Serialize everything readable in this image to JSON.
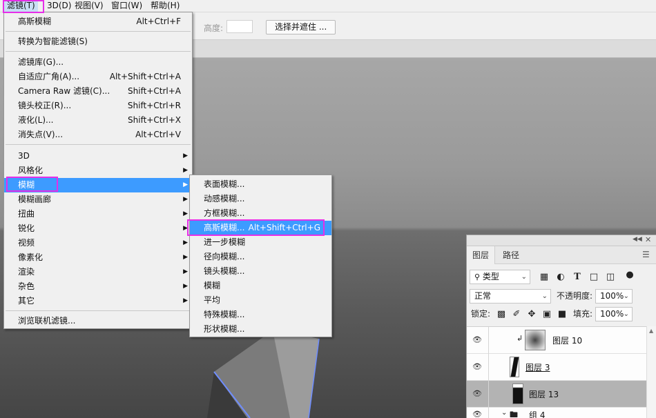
{
  "menubar": {
    "filter": "滤镜(T)",
    "3d": "3D(D)",
    "view": "视图(V)",
    "window": "窗口(W)",
    "help": "帮助(H)"
  },
  "options": {
    "height_label": "高度:",
    "height_value": "",
    "select_mask_button": "选择并遮住 ..."
  },
  "filter_menu": {
    "items": [
      {
        "label": "高斯模糊",
        "shortcut": "Alt+Ctrl+F"
      },
      {
        "label": "转换为智能滤镜(S)",
        "shortcut": ""
      },
      {
        "label": "滤镜库(G)...",
        "shortcut": ""
      },
      {
        "label": "自适应广角(A)...",
        "shortcut": "Alt+Shift+Ctrl+A"
      },
      {
        "label": "Camera Raw 滤镜(C)...",
        "shortcut": "Shift+Ctrl+A"
      },
      {
        "label": "镜头校正(R)...",
        "shortcut": "Shift+Ctrl+R"
      },
      {
        "label": "液化(L)...",
        "shortcut": "Shift+Ctrl+X"
      },
      {
        "label": "消失点(V)...",
        "shortcut": "Alt+Ctrl+V"
      },
      {
        "label": "3D",
        "shortcut": ""
      },
      {
        "label": "风格化",
        "shortcut": ""
      },
      {
        "label": "模糊",
        "shortcut": ""
      },
      {
        "label": "模糊画廊",
        "shortcut": ""
      },
      {
        "label": "扭曲",
        "shortcut": ""
      },
      {
        "label": "锐化",
        "shortcut": ""
      },
      {
        "label": "视频",
        "shortcut": ""
      },
      {
        "label": "像素化",
        "shortcut": ""
      },
      {
        "label": "渲染",
        "shortcut": ""
      },
      {
        "label": "杂色",
        "shortcut": ""
      },
      {
        "label": "其它",
        "shortcut": ""
      },
      {
        "label": "浏览联机滤镜...",
        "shortcut": ""
      }
    ]
  },
  "blur_submenu": {
    "items": [
      {
        "label": "表面模糊...",
        "shortcut": ""
      },
      {
        "label": "动感模糊...",
        "shortcut": ""
      },
      {
        "label": "方框模糊...",
        "shortcut": ""
      },
      {
        "label": "高斯模糊...",
        "shortcut": "Alt+Shift+Ctrl+G"
      },
      {
        "label": "进一步模糊",
        "shortcut": ""
      },
      {
        "label": "径向模糊...",
        "shortcut": ""
      },
      {
        "label": "镜头模糊...",
        "shortcut": ""
      },
      {
        "label": "模糊",
        "shortcut": ""
      },
      {
        "label": "平均",
        "shortcut": ""
      },
      {
        "label": "特殊模糊...",
        "shortcut": ""
      },
      {
        "label": "形状模糊...",
        "shortcut": ""
      }
    ]
  },
  "layers_panel": {
    "tab_layers": "图层",
    "tab_paths": "路径",
    "filter_kind": "类型",
    "blend_mode": "正常",
    "opacity_label": "不透明度:",
    "opacity_value": "100%",
    "lock_label": "锁定:",
    "fill_label": "填充:",
    "fill_value": "100%",
    "layers": [
      {
        "name": "图层 10"
      },
      {
        "name": "图层 3"
      },
      {
        "name": "图层 13"
      },
      {
        "name": "组 4"
      }
    ]
  },
  "colors": {
    "highlight": "#3d9bff",
    "annotation": "#e62ee8",
    "selected_layer": "#b3b3b3"
  }
}
